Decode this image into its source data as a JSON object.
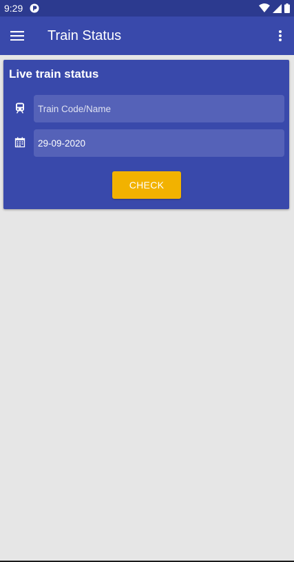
{
  "status_bar": {
    "time": "9:29",
    "icons": [
      "app-notification-icon",
      "wifi-icon",
      "signal-icon",
      "battery-icon"
    ]
  },
  "app_bar": {
    "title": "Train Status",
    "menu_icon": "hamburger-menu-icon",
    "overflow_icon": "more-vert-icon"
  },
  "card": {
    "title": "Live train status",
    "train_field": {
      "icon": "train-icon",
      "placeholder": "Train Code/Name",
      "value": ""
    },
    "date_field": {
      "icon": "calendar-icon",
      "value": "29-09-2020"
    },
    "check_label": "CHECK"
  },
  "colors": {
    "status_bar": "#2c3a8f",
    "primary": "#3949ab",
    "input_bg": "#5562b8",
    "accent": "#f2b200",
    "background": "#e6e6e6"
  }
}
